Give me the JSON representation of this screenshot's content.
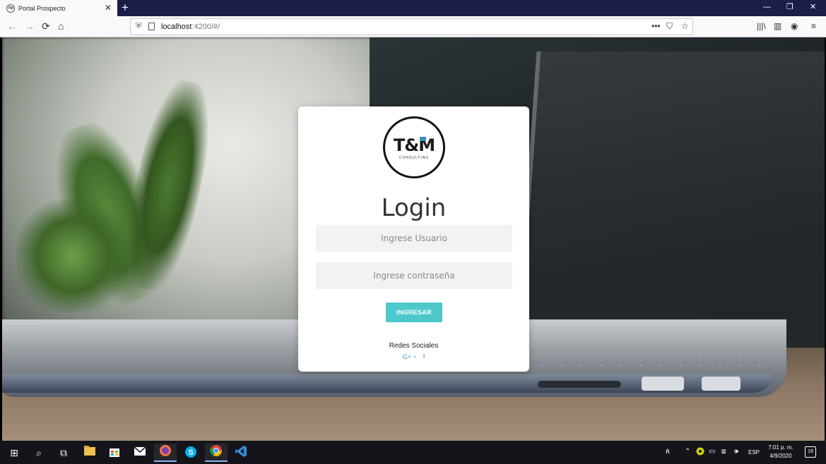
{
  "browser": {
    "tab_title": "Portal Prospecto",
    "tab_favicon_text": "TM",
    "tab_close": "✕",
    "new_tab": "+",
    "window_controls": {
      "minimize": "—",
      "restore": "❐",
      "close": "✕"
    },
    "nav": {
      "back": "←",
      "forward": "→",
      "reload": "⟳",
      "home": "⌂"
    },
    "url_host": "localhost",
    "url_rest": ":4200/#/",
    "url_actions": {
      "more": "•••",
      "pocket": "⛉",
      "bookmark": "☆"
    },
    "toolbar_right": {
      "library": "|||\\",
      "sidebar": "▥",
      "account": "◉",
      "menu": "≡"
    }
  },
  "login": {
    "logo_text": "T&M",
    "logo_subtext": "CONSULTING",
    "title": "Login",
    "username_placeholder": "Ingrese Usuario",
    "password_placeholder": "Ingrese contraseña",
    "submit_label": "INGRESAR",
    "social_label": "Redes Sociales",
    "social_icons": {
      "google": "G+",
      "github": "◔",
      "facebook": "f"
    }
  },
  "taskbar": {
    "start": "⊞",
    "search": "⌕",
    "task_view": "⧉",
    "apps": [
      "file-explorer",
      "store",
      "mail",
      "firefox",
      "skype",
      "chrome",
      "vscode"
    ],
    "tray": {
      "people": "ጰ",
      "chevron": "⌃",
      "language": "ESP"
    },
    "time": "7:01 p. m.",
    "date": "4/9/2020",
    "notification_count": "19"
  },
  "colors": {
    "accent_button": "#4dc8cb",
    "social_icon": "#4a90d6",
    "tab_strip": "#1d1d4a"
  }
}
